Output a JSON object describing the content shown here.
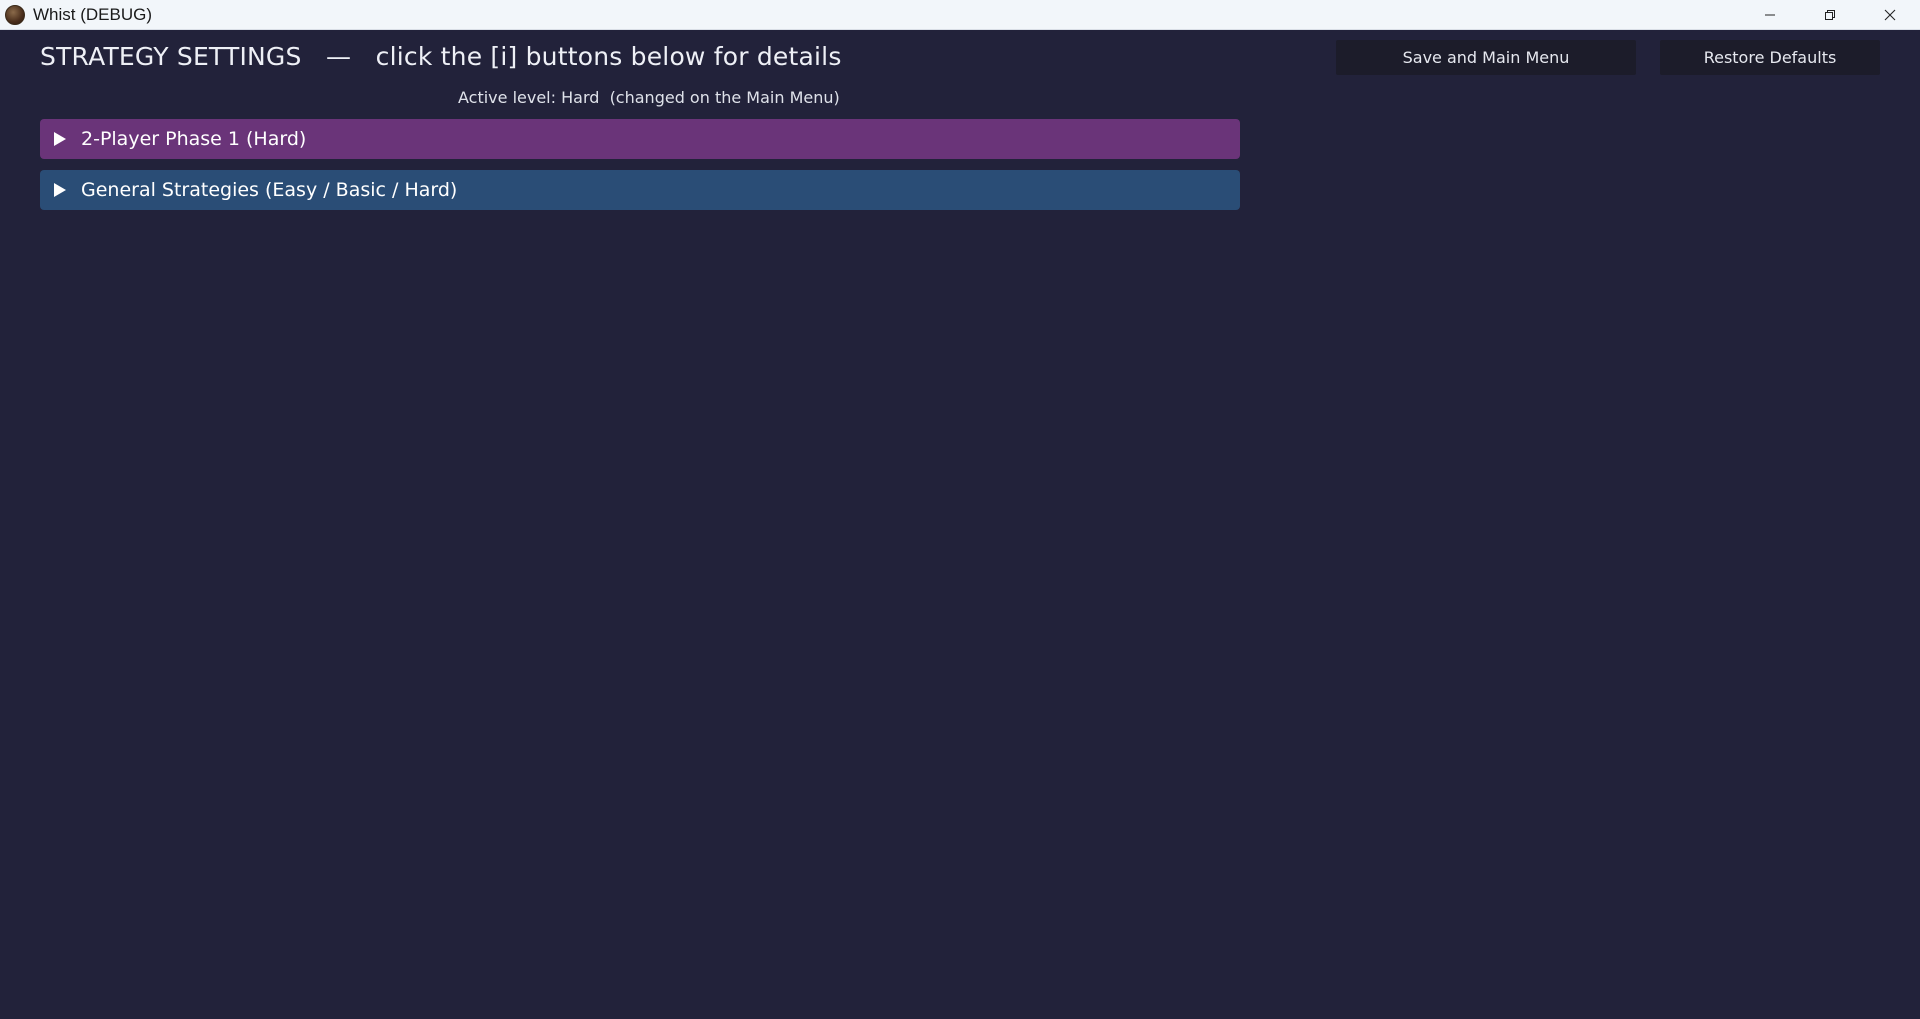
{
  "window": {
    "title": "Whist (DEBUG)",
    "controls": [
      "minimize-icon",
      "restore-icon",
      "close-icon"
    ]
  },
  "header": {
    "title": "STRATEGY SETTINGS   —   click the [i] buttons below for details",
    "active_level": "Active level: Hard  (changed on the Main Menu)"
  },
  "buttons": {
    "save": "Save and Main Menu",
    "restore": "Restore Defaults"
  },
  "sections": [
    {
      "label": "2-Player Phase 1 (Hard)",
      "color": "#6a3479",
      "expanded": false
    },
    {
      "label": "General Strategies (Easy / Basic / Hard)",
      "color": "#2a4d76",
      "expanded": false
    }
  ],
  "colors": {
    "background": "#22223a",
    "button_bg": "#1c1c2a",
    "titlebar_bg": "#f2f6fa"
  }
}
